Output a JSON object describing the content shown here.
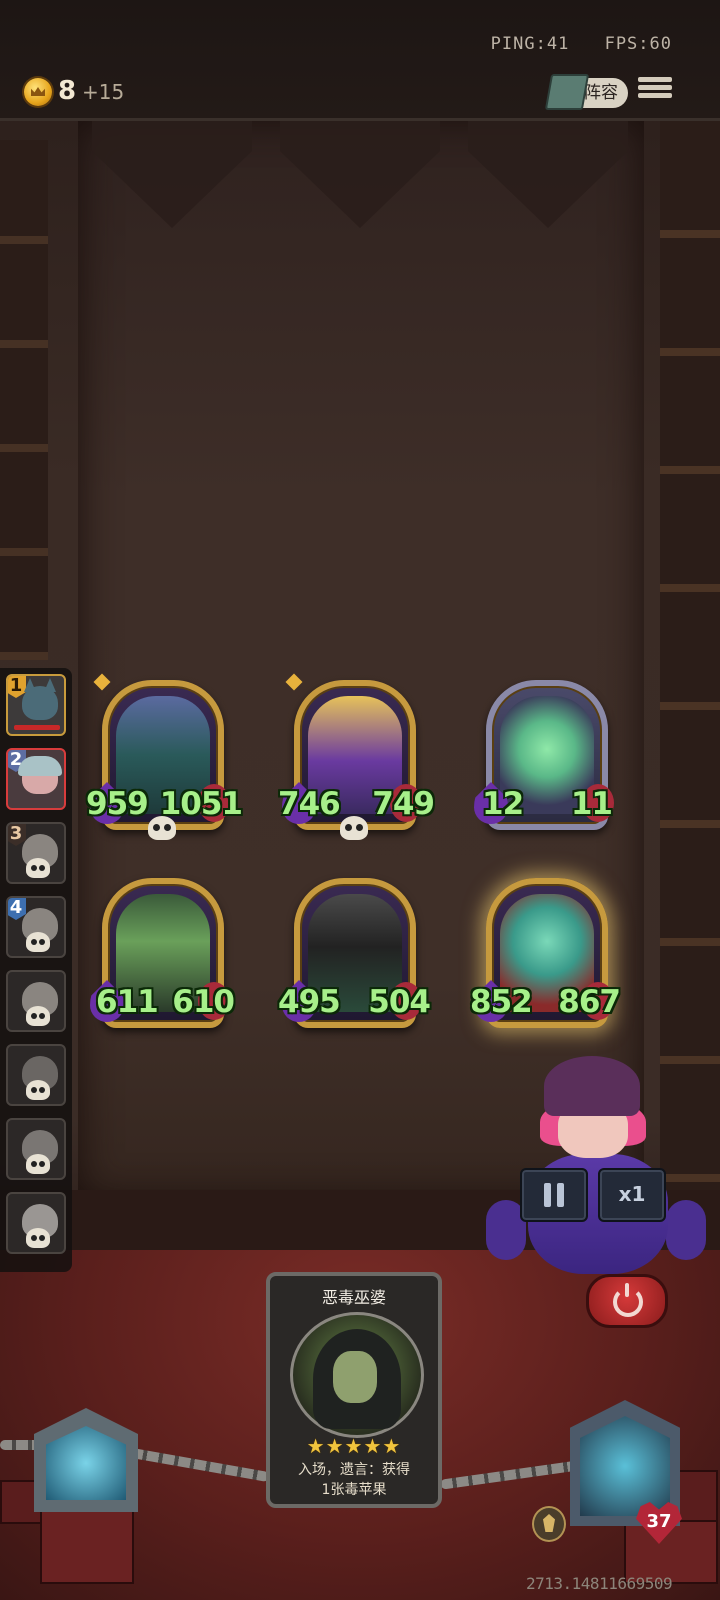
{
  "status": {
    "ping": "PING:41",
    "fps": "FPS:60"
  },
  "economy": {
    "gold": "8",
    "income": "+15"
  },
  "header": {
    "lineup_label": "阵容"
  },
  "players": [
    {
      "rank": "1",
      "portrait": "cat-hero",
      "state": "alive"
    },
    {
      "rank": "2",
      "portrait": "girl-hero",
      "state": "self"
    },
    {
      "rank": "3",
      "portrait": "wolf-hero",
      "state": "eliminated"
    },
    {
      "rank": "4",
      "portrait": "hat-hero",
      "state": "eliminated"
    },
    {
      "rank": "",
      "portrait": "ogre-hero",
      "state": "eliminated"
    },
    {
      "rank": "",
      "portrait": "dark-hair-hero",
      "state": "eliminated"
    },
    {
      "rank": "",
      "portrait": "boy-hero",
      "state": "eliminated"
    },
    {
      "rank": "",
      "portrait": "silver-hero",
      "state": "eliminated"
    }
  ],
  "board": {
    "row1": [
      {
        "attack": "959",
        "health": "1051",
        "art": "lich-king",
        "frame": "gold",
        "deathrattle": true
      },
      {
        "attack": "746",
        "health": "749",
        "art": "golden-totem",
        "frame": "gold",
        "deathrattle": true
      },
      {
        "attack": "12",
        "health": "11",
        "art": "ghost-cat",
        "frame": "silver",
        "deathrattle": false
      }
    ],
    "row2": [
      {
        "attack": "611",
        "health": "610",
        "art": "bone-sword",
        "frame": "gold",
        "deathrattle": false
      },
      {
        "attack": "495",
        "health": "504",
        "art": "grim-reaper",
        "frame": "gold",
        "deathrattle": false
      },
      {
        "attack": "852",
        "health": "867",
        "art": "ghost-witch",
        "frame": "gold-glow",
        "deathrattle": false
      }
    ]
  },
  "controls": {
    "speed_label": "x1",
    "pause_icon": "pause-icon",
    "quit_icon": "power-icon"
  },
  "hand_card": {
    "name": "恶毒巫婆",
    "stars": "★★★★★",
    "desc_line1": "入场，遗言：获得",
    "desc_line2": "1张毒苹果"
  },
  "hero": {
    "health": "37"
  },
  "session_id": "2713.14811669509",
  "colors": {
    "stat_green": "#a7f08a",
    "gold_frame": "#c69a3e",
    "health_red": "#b32638"
  }
}
